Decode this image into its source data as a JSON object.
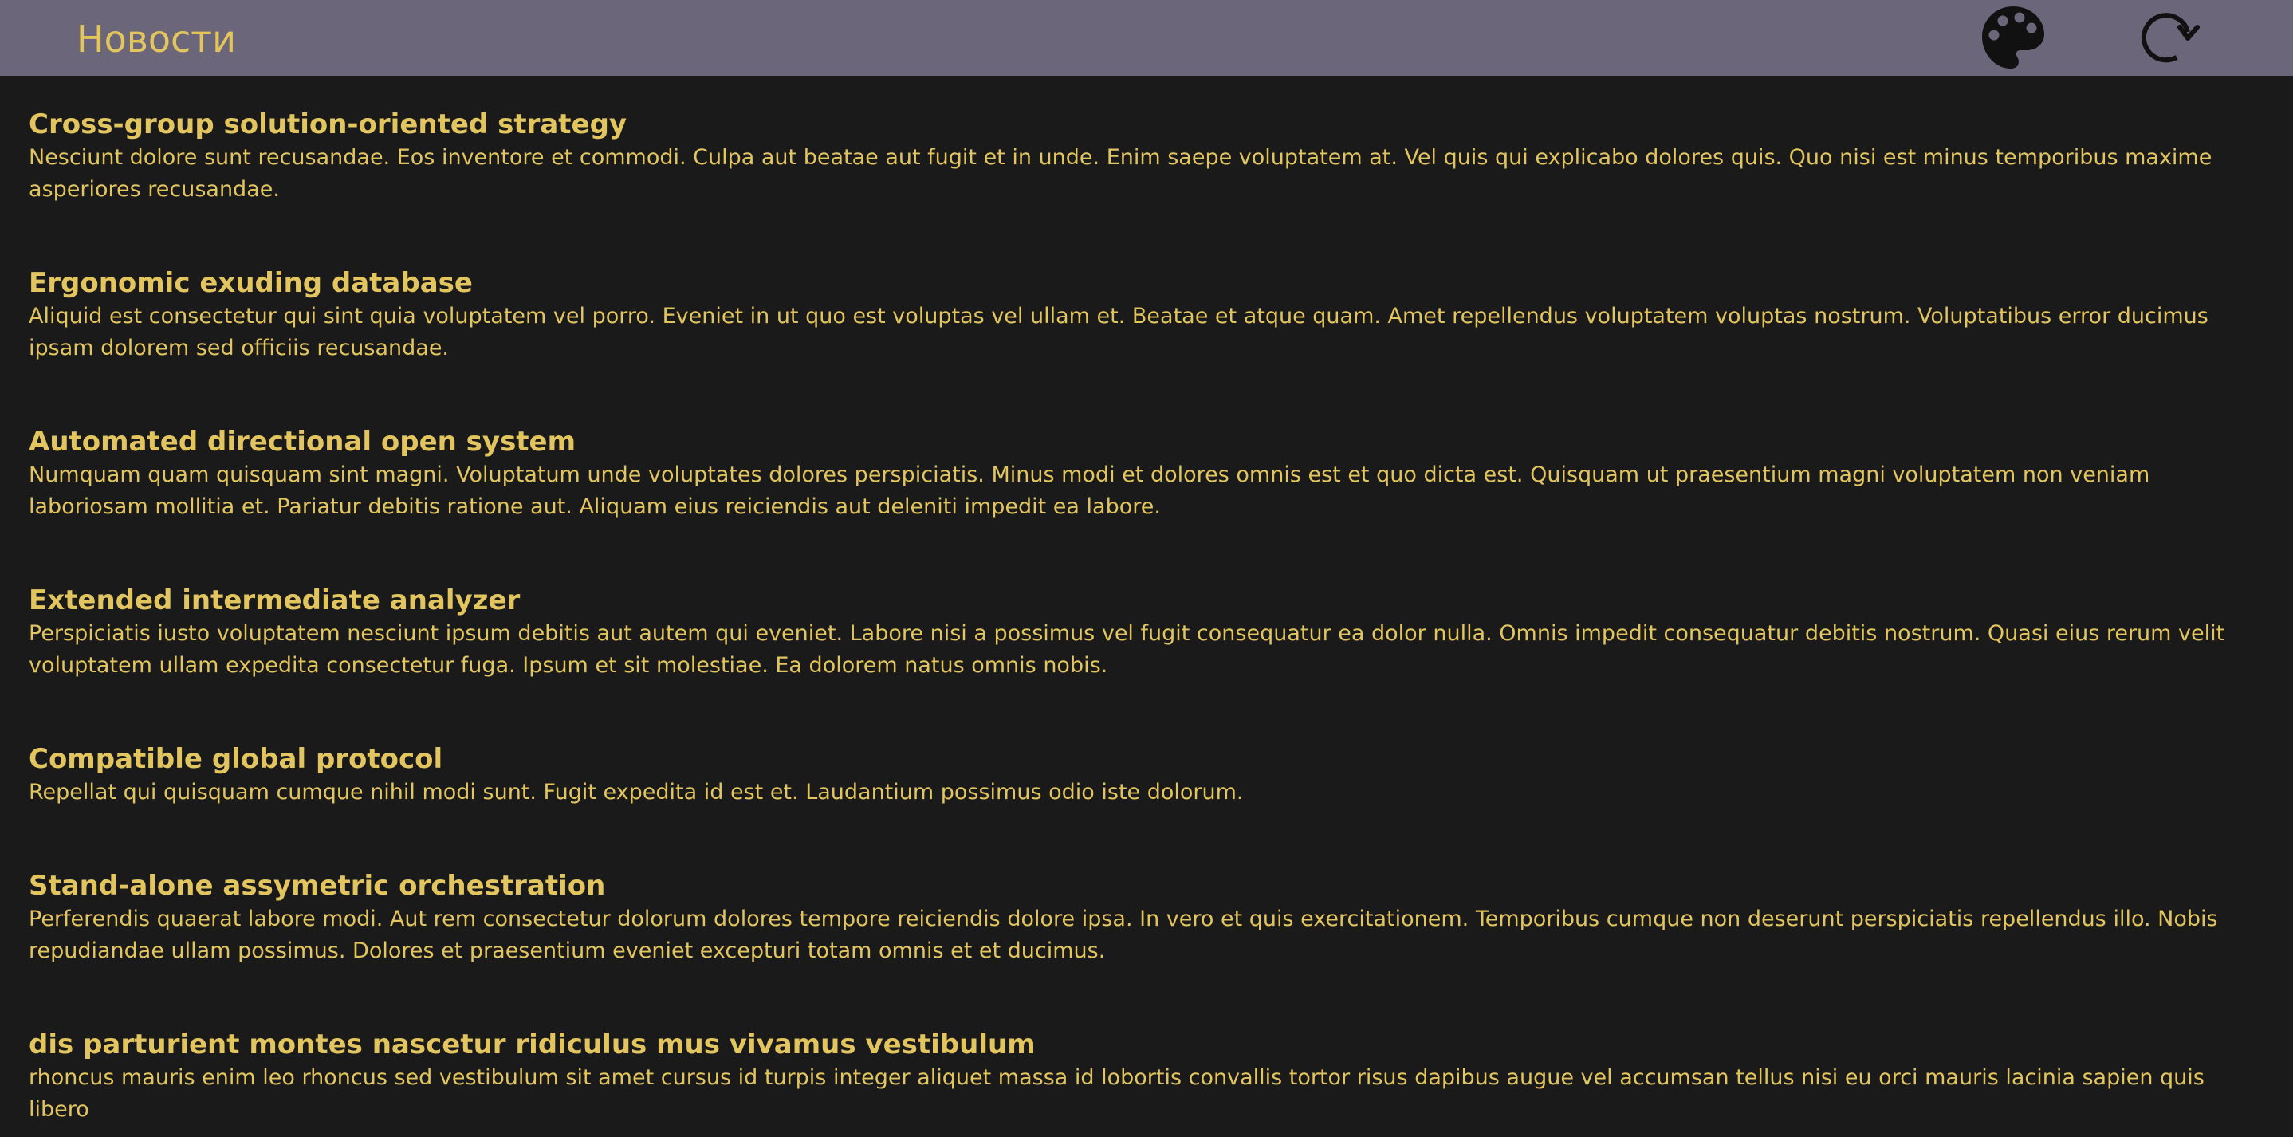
{
  "header": {
    "title": "Новости",
    "background_color": "#6b6679",
    "accent_color": "#e2c55e",
    "palette_icon": "palette-icon",
    "refresh_icon": "refresh-icon"
  },
  "news": [
    {
      "title": "Cross-group solution-oriented strategy",
      "text": "Nesciunt dolore sunt recusandae. Eos inventore et commodi. Culpa aut beatae aut fugit et in unde. Enim saepe voluptatem at. Vel quis qui explicabo dolores quis. Quo nisi est minus temporibus maxime asperiores recusandae."
    },
    {
      "title": "Ergonomic exuding database",
      "text": "Aliquid est consectetur qui sint quia voluptatem vel porro. Eveniet in ut quo est voluptas vel ullam et. Beatae et atque quam. Amet repellendus voluptatem voluptas nostrum. Voluptatibus error ducimus ipsam dolorem sed officiis recusandae."
    },
    {
      "title": "Automated directional open system",
      "text": "Numquam quam quisquam sint magni. Voluptatum unde voluptates dolores perspiciatis. Minus modi et dolores omnis est et quo dicta est. Quisquam ut praesentium magni voluptatem non veniam laboriosam mollitia et. Pariatur debitis ratione aut. Aliquam eius reiciendis aut deleniti impedit ea labore."
    },
    {
      "title": "Extended intermediate analyzer",
      "text": "Perspiciatis iusto voluptatem nesciunt ipsum debitis aut autem qui eveniet. Labore nisi a possimus vel fugit consequatur ea dolor nulla. Omnis impedit consequatur debitis nostrum. Quasi eius rerum velit voluptatem ullam expedita consectetur fuga. Ipsum et sit molestiae. Ea dolorem natus omnis nobis."
    },
    {
      "title": "Compatible global protocol",
      "text": "Repellat qui quisquam cumque nihil modi sunt. Fugit expedita id est et. Laudantium possimus odio iste dolorum."
    },
    {
      "title": "Stand-alone assymetric orchestration",
      "text": "Perferendis quaerat labore modi. Aut rem consectetur dolorum dolores tempore reiciendis dolore ipsa. In vero et quis exercitationem. Temporibus cumque non deserunt perspiciatis repellendus illo. Nobis repudiandae ullam possimus. Dolores et praesentium eveniet excepturi totam omnis et et ducimus."
    },
    {
      "title": "dis parturient montes nascetur ridiculus mus vivamus vestibulum",
      "text": "rhoncus mauris enim leo rhoncus sed vestibulum sit amet cursus id turpis integer aliquet massa id lobortis convallis tortor risus dapibus augue vel accumsan tellus nisi eu orci mauris lacinia sapien quis libero"
    }
  ]
}
